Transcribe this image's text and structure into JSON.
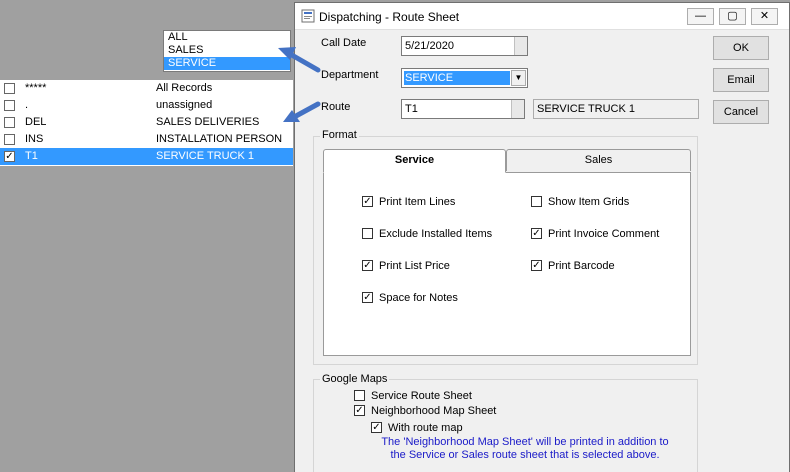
{
  "dropdown_popup": {
    "items": [
      "ALL",
      "SALES",
      "SERVICE"
    ],
    "selected_index": 2
  },
  "route_list": {
    "rows": [
      {
        "code": "*****",
        "description": "All Records",
        "checked": false,
        "selected": false
      },
      {
        "code": ".",
        "description": "unassigned",
        "checked": false,
        "selected": false
      },
      {
        "code": "DEL",
        "description": "SALES DELIVERIES",
        "checked": false,
        "selected": false
      },
      {
        "code": "INS",
        "description": "INSTALLATION PERSON",
        "checked": false,
        "selected": false
      },
      {
        "code": "T1",
        "description": "SERVICE TRUCK 1",
        "checked": true,
        "selected": true
      }
    ]
  },
  "window": {
    "title": "Dispatching - Route Sheet",
    "minimize": "—",
    "maximize": "▢",
    "close": "✕"
  },
  "form": {
    "call_date_label": "Call Date",
    "call_date_value": "5/21/2020",
    "department_label": "Department",
    "department_value": "SERVICE",
    "route_label": "Route",
    "route_value": "T1",
    "route_description": "SERVICE TRUCK 1"
  },
  "buttons": {
    "ok": "OK",
    "email": "Email",
    "cancel": "Cancel"
  },
  "format": {
    "group_label": "Format",
    "tabs": [
      {
        "label": "Service",
        "active": true
      },
      {
        "label": "Sales",
        "active": false
      }
    ],
    "options": [
      {
        "label": "Print Item Lines",
        "checked": true
      },
      {
        "label": "Exclude Installed Items",
        "checked": false
      },
      {
        "label": "Print List Price",
        "checked": true
      },
      {
        "label": "Space for  Notes",
        "checked": true
      },
      {
        "label": "Show Item Grids",
        "checked": false
      },
      {
        "label": "Print Invoice Comment",
        "checked": true
      },
      {
        "label": "Print Barcode",
        "checked": true
      }
    ]
  },
  "google_maps": {
    "group_label": "Google Maps",
    "service_route_sheet": {
      "label": "Service Route Sheet",
      "checked": false
    },
    "neighborhood_map_sheet": {
      "label": "Neighborhood Map Sheet",
      "checked": true
    },
    "with_route_map": {
      "label": "With route map",
      "checked": true
    },
    "note_line1": "The 'Neighborhood Map Sheet' will be printed in addition to",
    "note_line2": "the Service or Sales route sheet that is selected above."
  },
  "colors": {
    "selection": "#3399ff",
    "arrow": "#4472c4",
    "note_text": "#1a1ac8"
  }
}
